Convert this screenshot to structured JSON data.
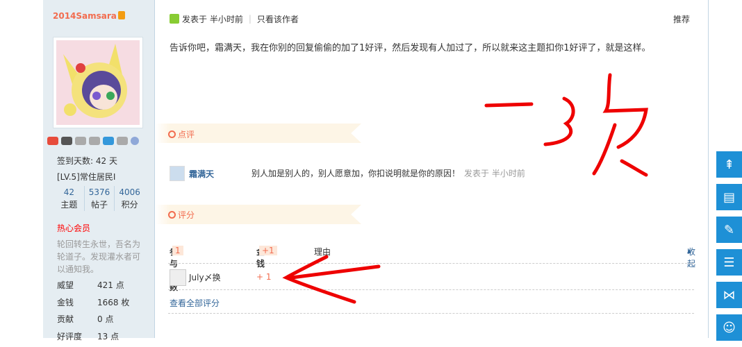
{
  "user": {
    "name": "2014Samsara",
    "checkin": "签到天数: 42 天",
    "level": "[LV.5]常住居民I",
    "stats": [
      {
        "num": "42",
        "label": "主题"
      },
      {
        "num": "5376",
        "label": "帖子"
      },
      {
        "num": "4006",
        "label": "积分"
      }
    ],
    "badge_title": "热心会员",
    "motto": "轮回转生永世，吾名为轮道子。发现灌水者可以通知我。",
    "props": [
      {
        "k": "威望",
        "v": "421 点"
      },
      {
        "k": "金钱",
        "v": "1668 枚"
      },
      {
        "k": "贡献",
        "v": "0 点"
      },
      {
        "k": "好评度",
        "v": "13 点"
      }
    ]
  },
  "post": {
    "posted": "发表于 半小时前",
    "only_author": "只看该作者",
    "recommend": "推荐",
    "content": "告诉你吧，霜满天，我在你别的回复偷偷的加了1好评，然后发现有人加过了，所以就来这主题扣你1好评了，就是这样。"
  },
  "comment": {
    "section_title": "点评",
    "user": "霜满天",
    "text": "别人加是别人的，别人愿意加，你扣说明就是你的原因！",
    "time": "发表于 半小时前"
  },
  "rating": {
    "section_title": "评分",
    "participants_label": "参与人数",
    "participants_count": "1",
    "money_label": "金钱",
    "money_total": "+1",
    "reason_label": "理由",
    "collapse": "收起",
    "user": "July〆换",
    "value": "+ 1",
    "view_all": "查看全部评分"
  },
  "floating_buttons": [
    "top-icon",
    "list-icon",
    "edit-icon",
    "menu-icon",
    "share-icon",
    "user-icon"
  ],
  "colors": {
    "accent": "#f26c4f",
    "link": "#336699",
    "float": "#1e90d6",
    "scribble": "#ee0000"
  }
}
